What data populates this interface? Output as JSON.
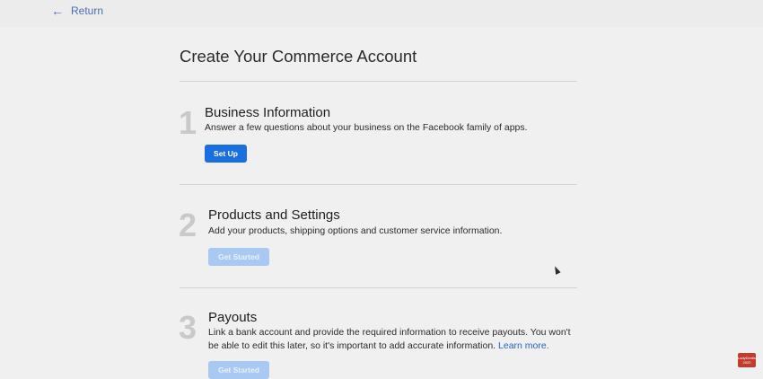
{
  "nav": {
    "return_label": "Return"
  },
  "page": {
    "title": "Create Your Commerce Account"
  },
  "steps": [
    {
      "number": "1",
      "title": "Business Information",
      "description": "Answer a few questions about your business on the Facebook family of apps.",
      "button_label": "Set Up",
      "button_state": "enabled"
    },
    {
      "number": "2",
      "title": "Products and Settings",
      "description": "Add your products, shipping options and customer service information.",
      "button_label": "Get Started",
      "button_state": "disabled"
    },
    {
      "number": "3",
      "title": "Payouts",
      "description": "Link a bank account and provide the required information to receive payouts. You won't be able to edit this later, so it's important to add accurate information.",
      "link_label": "Learn more.",
      "button_label": "Get Started",
      "button_state": "disabled"
    }
  ],
  "watermark": {
    "text": "LadyDentist 2020"
  },
  "colors": {
    "primary": "#1a6fe0",
    "disabled": "#a9c9f2",
    "link": "#2463c7",
    "step_number": "#c9c9c9"
  }
}
